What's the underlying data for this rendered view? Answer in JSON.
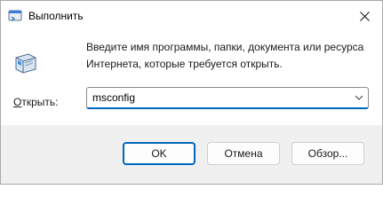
{
  "window": {
    "title": "Выполнить",
    "close_icon": "close-icon"
  },
  "main": {
    "description_line1": "Введите имя программы, папки, документа или ресурса",
    "description_line2": "Интернета, которые требуется открыть.",
    "open_label_underlined": "О",
    "open_label_rest": "ткрыть:",
    "open_value": "msconfig"
  },
  "buttons": {
    "ok": "OK",
    "cancel": "Отмена",
    "browse": "Обзор..."
  },
  "colors": {
    "accent": "#0067c0",
    "footer_bg": "#f0f0f0"
  }
}
